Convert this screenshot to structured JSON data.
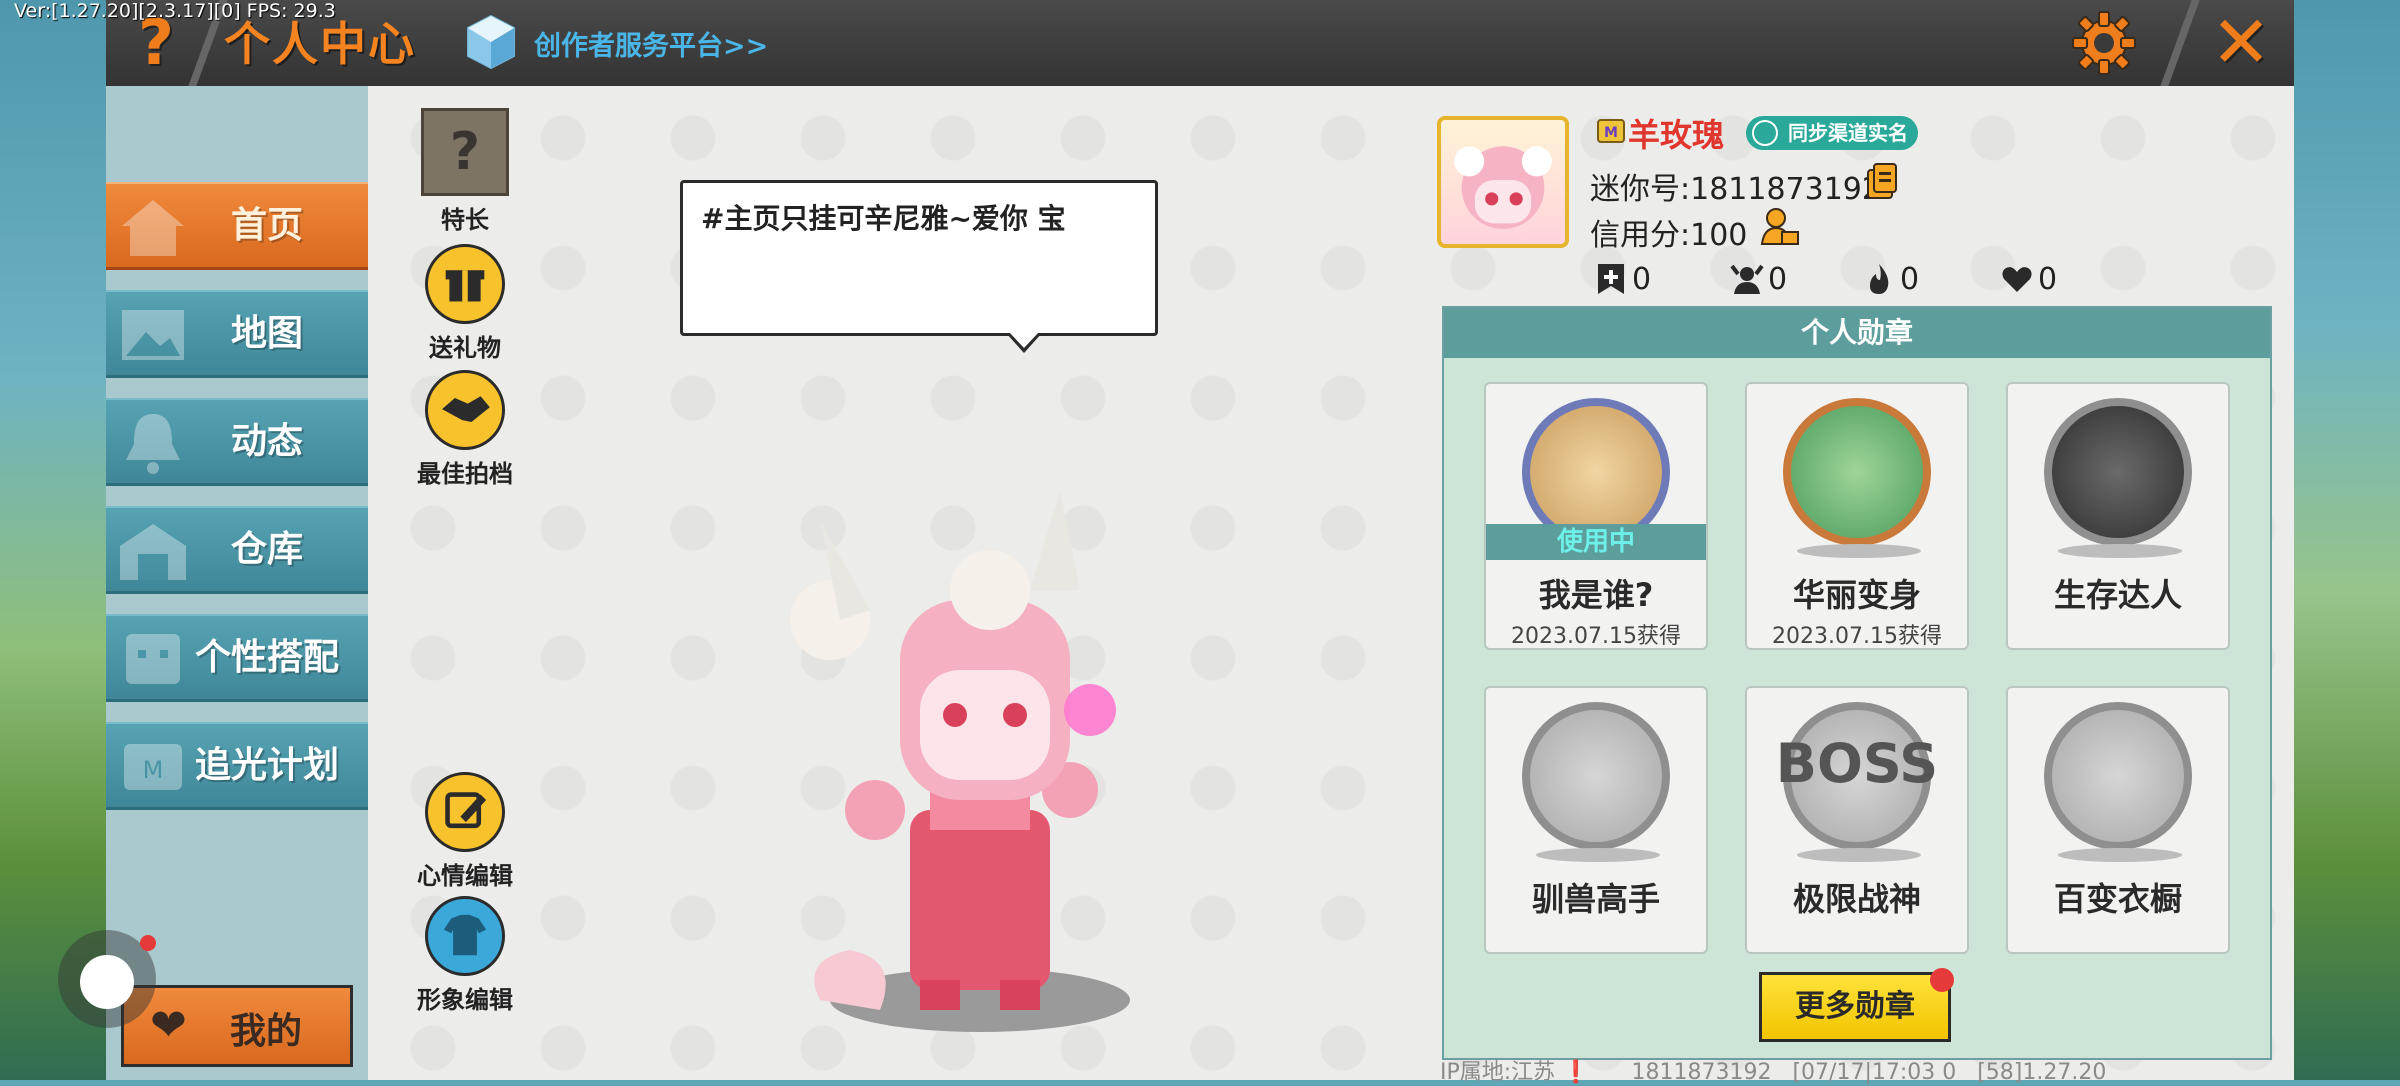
{
  "debug": {
    "version": "Ver:[1.27.20][2.3.17][0] FPS: 29.3"
  },
  "topbar": {
    "help": "?",
    "title": "个人中心",
    "creator_link": "创作者服务平台>>",
    "close": "✕"
  },
  "nav": {
    "items": [
      {
        "label": "首页",
        "active": true
      },
      {
        "label": "地图"
      },
      {
        "label": "动态"
      },
      {
        "label": "仓库"
      },
      {
        "label": "个性搭配"
      },
      {
        "label": "追光计划"
      }
    ],
    "mine_label": "我的"
  },
  "actions": {
    "specialty": "特长",
    "gift": "送礼物",
    "partner": "最佳拍档",
    "mood": "心情编辑",
    "appearance": "形象编辑"
  },
  "speech_text": "#主页只挂可辛尼雅~爱你   宝",
  "profile": {
    "name": "羊玫瑰",
    "realname_badge": "同步渠道实名",
    "mini_id": "迷你号:1811873192",
    "credit": "信用分:100",
    "stats": [
      {
        "icon": "plus-bookmark-icon",
        "value": "0"
      },
      {
        "icon": "fans-icon",
        "value": "0"
      },
      {
        "icon": "flame-icon",
        "value": "0"
      },
      {
        "icon": "hearts-icon",
        "value": "0"
      }
    ]
  },
  "medals": {
    "header": "个人勋章",
    "in_use_label": "使用中",
    "items": [
      {
        "name": "我是谁?",
        "date": "2023.07.15获得"
      },
      {
        "name": "华丽变身",
        "date": "2023.07.15获得"
      },
      {
        "name": "生存达人"
      },
      {
        "name": "驯兽高手"
      },
      {
        "name": "极限战神"
      },
      {
        "name": "百变衣橱"
      }
    ],
    "more_button": "更多勋章"
  },
  "footer": "IP属地:江苏 ❗      1811873192   [07/17|17:03 0   [58]1.27.20",
  "colors": {
    "accent_orange": "#f07d1b",
    "nav_teal": "#4a97a8",
    "medal_header": "#5d9e9d",
    "name_red": "#e0362e"
  }
}
